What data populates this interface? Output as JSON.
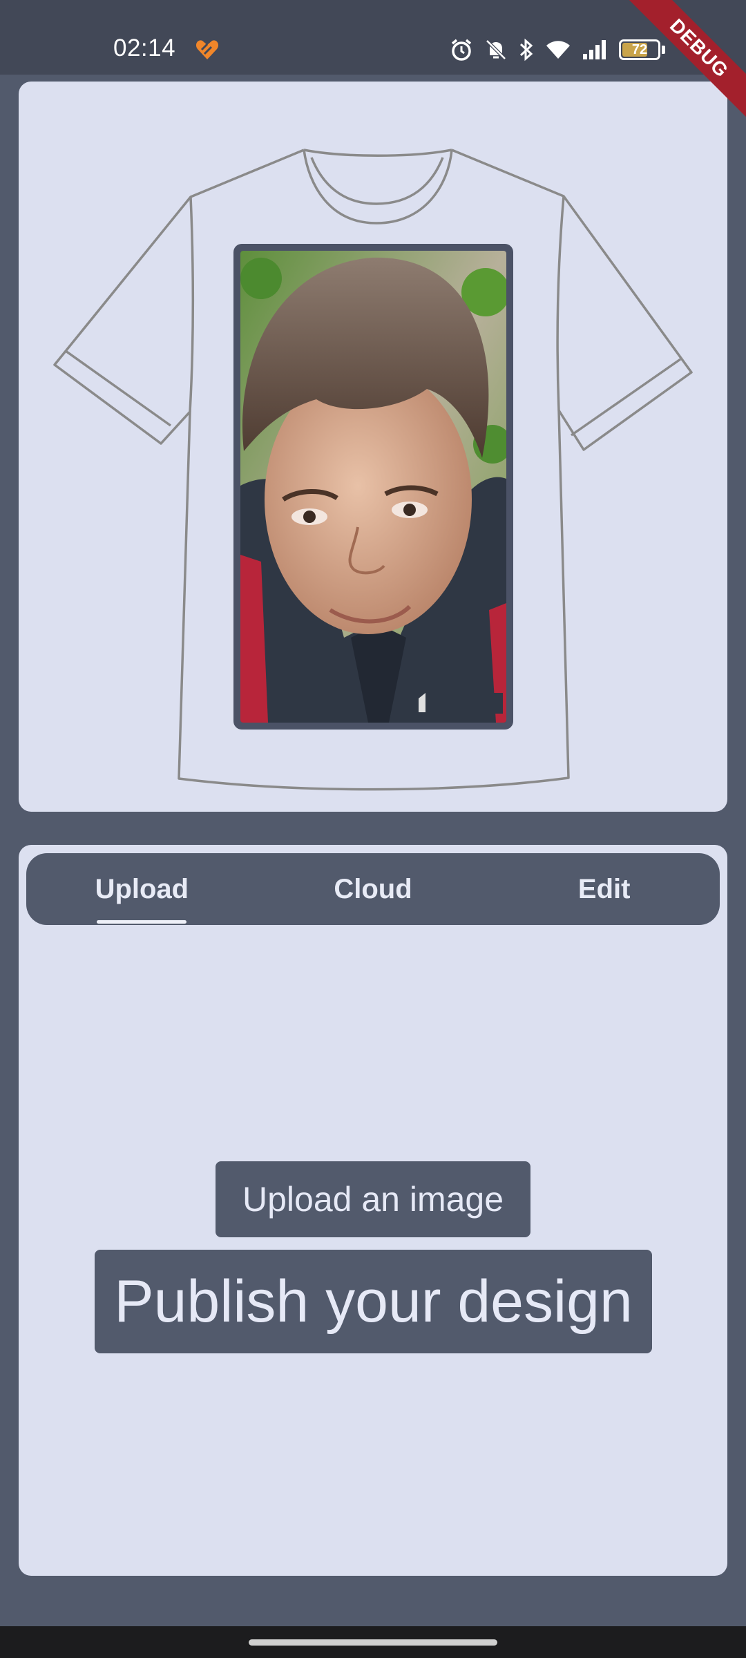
{
  "status_bar": {
    "time": "02:14",
    "battery_level": "72",
    "battery_fraction": 0.72,
    "icons": [
      "app-heart-icon",
      "alarm-icon",
      "bell-off-icon",
      "bluetooth-icon",
      "wifi-icon",
      "signal-icon",
      "battery-icon"
    ]
  },
  "debug_banner": {
    "label": "DEBUG"
  },
  "preview": {
    "shirt_icon": "tshirt-outline-icon",
    "photo_icon": "user-photo"
  },
  "tabs": [
    {
      "label": "Upload",
      "active": true
    },
    {
      "label": "Cloud",
      "active": false
    },
    {
      "label": "Edit",
      "active": false
    }
  ],
  "actions": {
    "upload_label": "Upload an image",
    "publish_label": "Publish your design"
  },
  "colors": {
    "background": "#525a6c",
    "surface": "#dce0f0",
    "accent_banner": "#a3202c",
    "battery": "#c9a44a"
  }
}
